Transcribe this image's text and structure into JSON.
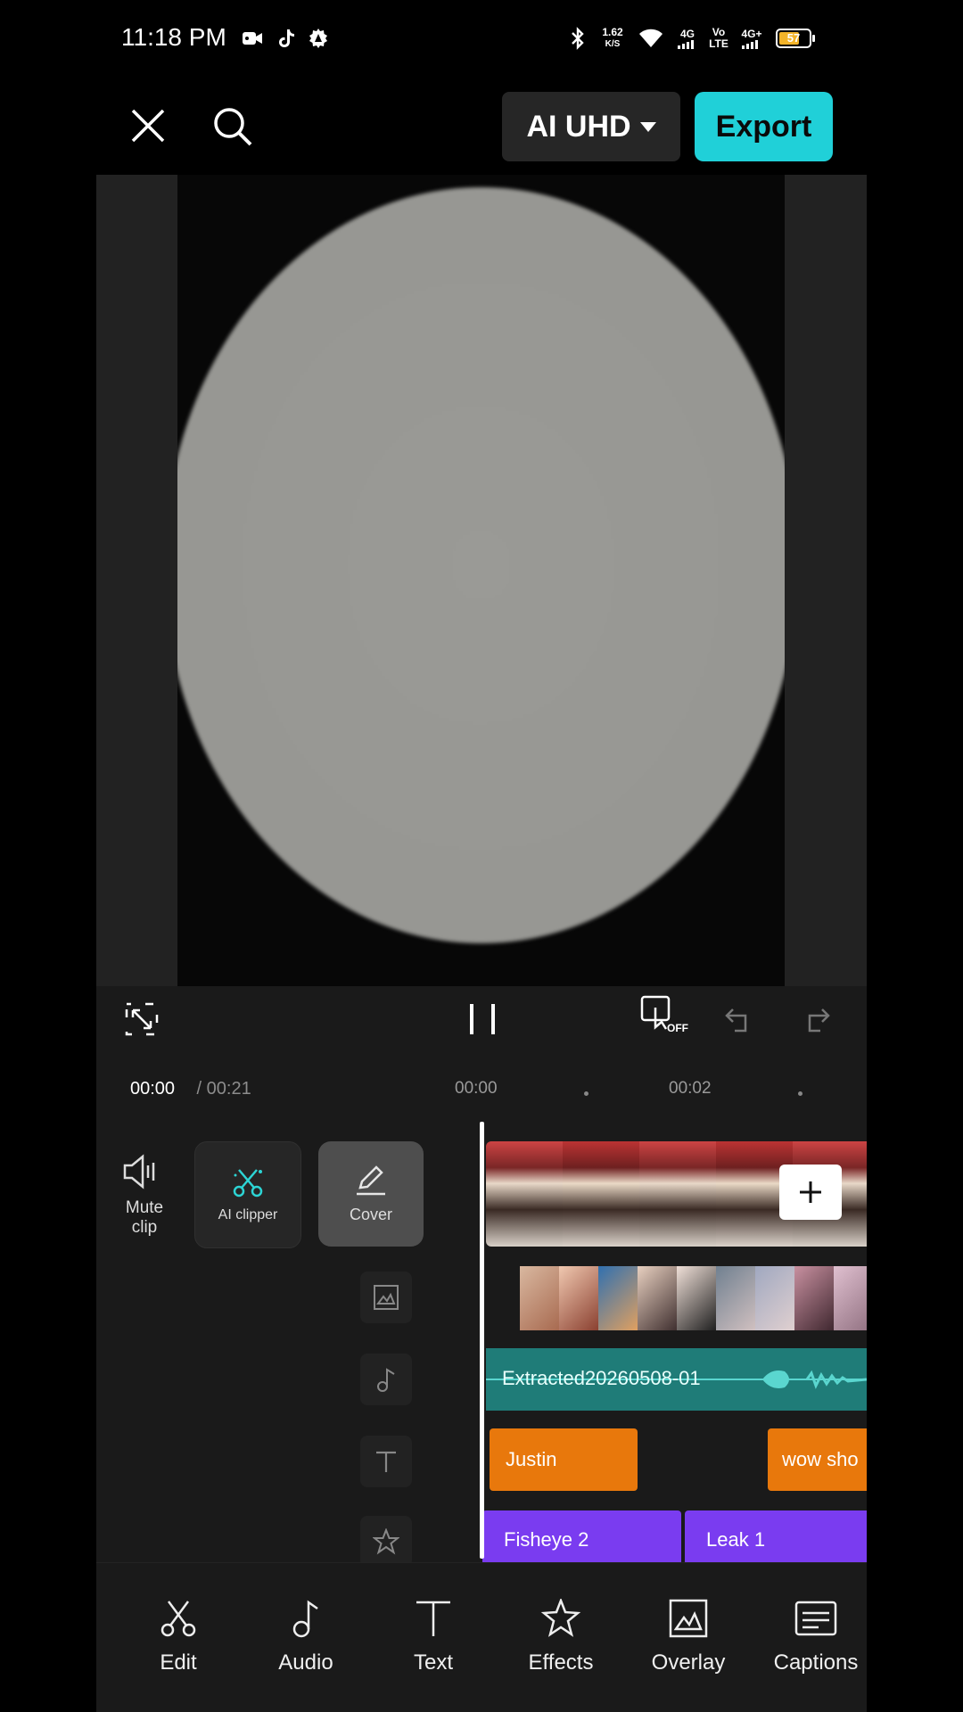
{
  "status_bar": {
    "time": "11:18 PM",
    "net_speed_value": "1.62",
    "net_speed_unit": "K/S",
    "sim1": "4G",
    "volte_top": "Vo",
    "volte_bottom": "LTE",
    "sim2": "4G+",
    "battery": "57"
  },
  "top_bar": {
    "quality_label": "AI UHD",
    "export_label": "Export"
  },
  "playback": {
    "current_time": "00:00",
    "separator": " / ",
    "total_time": "00:21",
    "ruler_marks": [
      "00:00",
      "00:02"
    ],
    "loop_badge": "OFF"
  },
  "tools": {
    "mute_label": "Mute clip",
    "ai_clipper_label": "AI clipper",
    "cover_label": "Cover"
  },
  "timeline": {
    "audio_clip": "Extracted20260508-01",
    "text_clips": [
      "Justin",
      "wow sho"
    ],
    "effect_clips": [
      "Fisheye 2",
      "Leak 1"
    ]
  },
  "bottom_nav": [
    "Edit",
    "Audio",
    "Text",
    "Effects",
    "Overlay",
    "Captions"
  ],
  "colors": {
    "accent": "#20d0d8",
    "text_track": "#e8780c",
    "effect_track": "#7a3cf0",
    "audio_track": "#1f7c78"
  }
}
